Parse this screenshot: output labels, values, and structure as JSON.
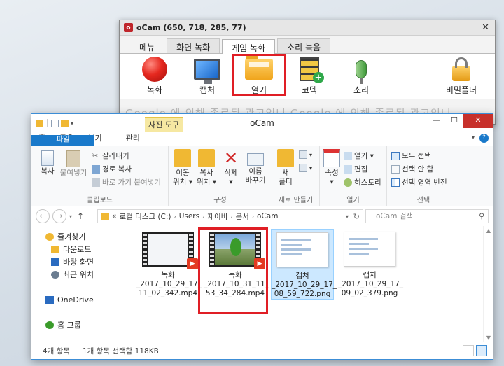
{
  "ocam": {
    "title": "oCam (650, 718, 285, 77)",
    "logo": "o",
    "tabs": [
      "메뉴",
      "화면 녹화",
      "게임 녹화",
      "소리 녹음"
    ],
    "active_tab_index": 2,
    "tools": [
      {
        "label": "녹화",
        "icon": "record-icon"
      },
      {
        "label": "캡처",
        "icon": "monitor-icon"
      },
      {
        "label": "열기",
        "icon": "folder-icon",
        "highlighted": true
      },
      {
        "label": "코덱",
        "icon": "codec-icon"
      },
      {
        "label": "소리",
        "icon": "microphone-icon"
      },
      {
        "label": "비밀폴더",
        "icon": "lock-icon"
      }
    ],
    "ad_text": "Google 에 의해 종료된 광고입니 Google 에 의해 종료된 광고입니"
  },
  "explorer": {
    "title": "oCam",
    "context_tab": "사진 도구",
    "ribbon_tabs": [
      "파일",
      "홈",
      "공유",
      "보기",
      "관리"
    ],
    "groups": {
      "clipboard": {
        "label": "클립보드",
        "copy": "복사",
        "paste": "붙여넣기",
        "cut": "잘라내기",
        "copy_path": "경로 복사",
        "paste_shortcut": "바로 가기 붙여넣기"
      },
      "organize": {
        "label": "구성",
        "move_to": "이동\n위치 ▾",
        "copy_to": "복사\n위치 ▾",
        "delete": "삭제\n▾",
        "rename": "이름\n바꾸기"
      },
      "new": {
        "label": "새로 만들기",
        "new_folder": "새\n폴더"
      },
      "open": {
        "label": "열기",
        "properties": "속성\n▾",
        "open": "열기 ▾",
        "edit": "편집",
        "history": "히스토리"
      },
      "select": {
        "label": "선택",
        "select_all": "모두 선택",
        "select_none": "선택 안 함",
        "invert": "선택 영역 반전"
      }
    },
    "address": {
      "overflow": "«",
      "crumbs": [
        "로컬 디스크 (C:)",
        "Users",
        "제이비",
        "문서",
        "oCam"
      ]
    },
    "search_placeholder": "oCam 검색",
    "nav": [
      {
        "label": "즐겨찾기",
        "icon": "star-icon",
        "color": "#f0b833"
      },
      {
        "label": "다운로드",
        "icon": "download-folder-icon",
        "color": "#f0b833"
      },
      {
        "label": "바탕 화면",
        "icon": "desktop-icon",
        "color": "#2a6bc0"
      },
      {
        "label": "최근 위치",
        "icon": "recent-icon",
        "color": "#6a7c90"
      },
      {
        "label": "",
        "icon": "",
        "color": ""
      },
      {
        "label": "OneDrive",
        "icon": "cloud-icon",
        "color": "#2a6bc0"
      },
      {
        "label": "",
        "icon": "",
        "color": ""
      },
      {
        "label": "홈 그룹",
        "icon": "homegroup-icon",
        "color": "#3a9b2a"
      }
    ],
    "files": [
      {
        "name": "녹화\n_2017_10_29_17_\n11_02_342.mp4",
        "type": "video"
      },
      {
        "name": "녹화\n_2017_10_31_11_\n53_34_284.mp4",
        "type": "video-green",
        "highlighted": true
      },
      {
        "name": "캡처\n_2017_10_29_17_\n08_59_722.png",
        "type": "png",
        "selected": true
      },
      {
        "name": "캡처\n_2017_10_29_17_\n09_02_379.png",
        "type": "png"
      }
    ],
    "status": {
      "item_count": "4개 항목",
      "selection": "1개 항목 선택함 118KB"
    }
  },
  "colors": {
    "highlight_red": "#e01e25",
    "file_tab_blue": "#1979ca",
    "context_tab_yellow": "#f6e8a2"
  }
}
